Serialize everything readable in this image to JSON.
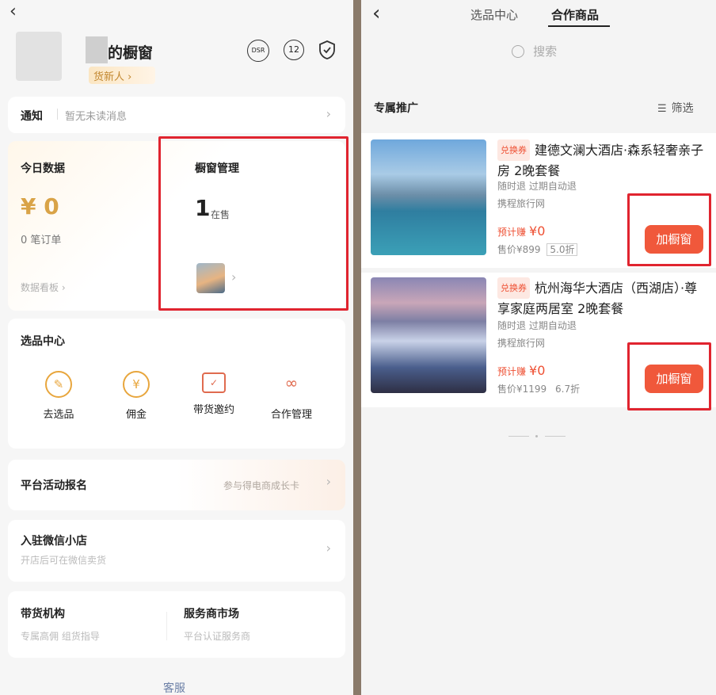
{
  "left": {
    "shop_title": "的橱窗",
    "level_badge": "货新人 ›",
    "header_icons": {
      "dsr": "DSR",
      "level": "12",
      "shield": "shield-icon"
    },
    "notice": {
      "label": "通知",
      "value": "暂无未读消息"
    },
    "today": {
      "title": "今日数据",
      "amount": "¥ 0",
      "orders": "0 笔订单",
      "board_link": "数据看板 ›"
    },
    "showcase": {
      "title": "橱窗管理",
      "count": "1",
      "count_label": "在售"
    },
    "selection": {
      "title": "选品中心",
      "items": [
        {
          "label": "去选品",
          "icon": "pick-icon"
        },
        {
          "label": "佣金",
          "icon": "yen-icon"
        },
        {
          "label": "带货邀约",
          "icon": "envelope-icon"
        },
        {
          "label": "合作管理",
          "icon": "cooperation-icon"
        }
      ]
    },
    "activity": {
      "label": "平台活动报名",
      "right": "参与得电商成长卡"
    },
    "weixin_store": {
      "label": "入驻微信小店",
      "sub": "开店后可在微信卖货"
    },
    "agency": {
      "label": "带货机构",
      "sub": "专属高佣 组货指导"
    },
    "market": {
      "label": "服务商市场",
      "sub": "平台认证服务商"
    },
    "service": "客服"
  },
  "right": {
    "tabs": [
      "选品中心",
      "合作商品"
    ],
    "active_tab": 1,
    "search_placeholder": "搜索",
    "section_title": "专属推广",
    "filter_label": "筛选",
    "products": [
      {
        "tag": "兑换券",
        "title": "建德文澜大酒店·森系轻奢亲子房 2晚套餐",
        "policy": "随时退  过期自动退",
        "platform": "携程旅行网",
        "earn_label": "预计赚",
        "earn": "¥0",
        "price": "售价¥899",
        "discount": "5.0折",
        "button": "加橱窗"
      },
      {
        "tag": "兑换券",
        "title": "杭州海华大酒店（西湖店）·尊享家庭两居室 2晚套餐",
        "policy": "随时退  过期自动退",
        "platform": "携程旅行网",
        "earn_label": "预计赚",
        "earn": "¥0",
        "price": "售价¥1199",
        "discount": "6.7折",
        "button": "加橱窗"
      }
    ],
    "colors": {
      "accent": "#f0583b",
      "highlight_box": "#e0242f"
    }
  }
}
